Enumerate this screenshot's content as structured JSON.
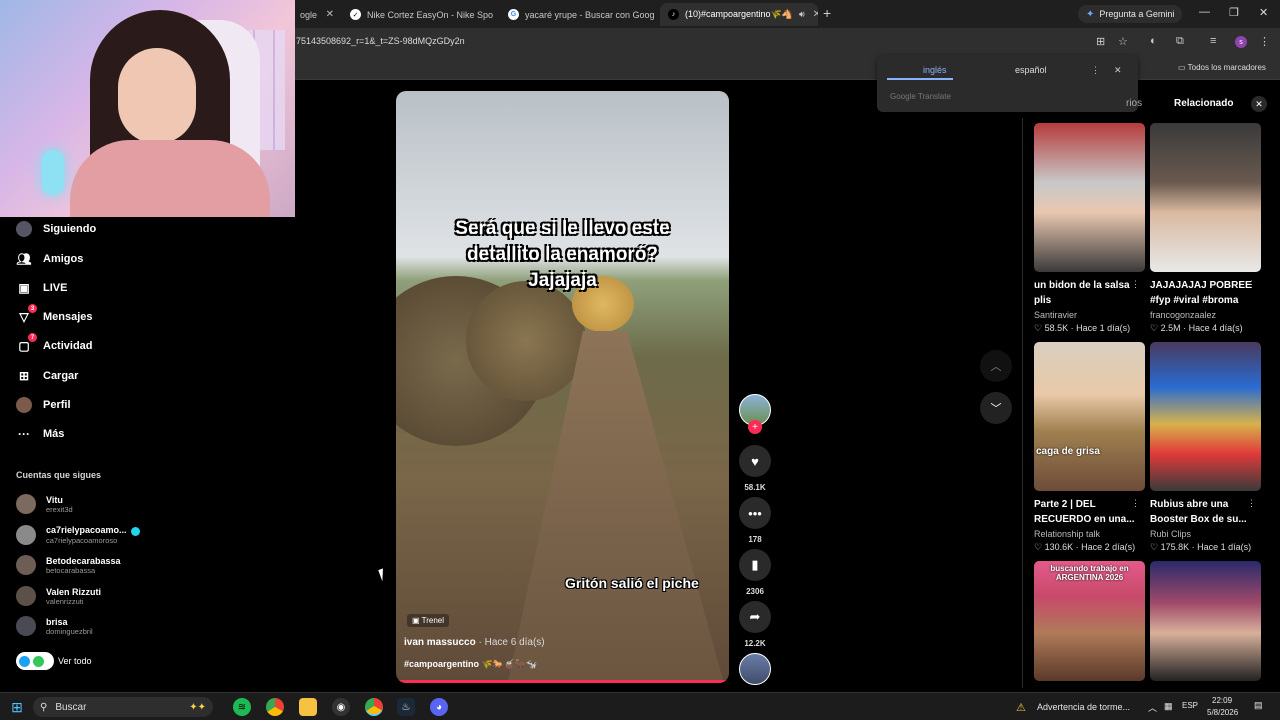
{
  "browser": {
    "tabs": [
      {
        "label": "ogle"
      },
      {
        "label": "Nike Cortez EasyOn - Nike Spo"
      },
      {
        "label": "yacaré yrupe - Buscar con Goog"
      },
      {
        "label": "(10)#campoargentino🌾🐴"
      }
    ],
    "gemini_label": "Pregunta a Gemini",
    "url": "75143508692_r=1&_t=ZS-98dMQzGDy2n",
    "all_bookmarks": "Todos los marcadores"
  },
  "translate": {
    "lang_source": "inglés",
    "lang_target": "español",
    "footer": "Google Translate"
  },
  "nav": {
    "items": [
      {
        "label": "Siguiendo",
        "icon": "following-avatar-icon"
      },
      {
        "label": "Amigos",
        "icon": "friends-icon"
      },
      {
        "label": "LIVE",
        "icon": "live-icon"
      },
      {
        "label": "Mensajes",
        "icon": "messages-icon",
        "badge": "3"
      },
      {
        "label": "Actividad",
        "icon": "activity-icon",
        "badge": "7"
      },
      {
        "label": "Cargar",
        "icon": "upload-icon"
      },
      {
        "label": "Perfil",
        "icon": "profile-icon"
      },
      {
        "label": "Más",
        "icon": "more-icon"
      }
    ],
    "following_heading": "Cuentas que sigues",
    "accounts": [
      {
        "name": "Vitu",
        "user": "erexit3d",
        "verified": false
      },
      {
        "name": "ca7rielypacoamo...",
        "user": "ca7rielypacoamoroso",
        "verified": true
      },
      {
        "name": "Betodecarabassa",
        "user": "betocarabassa",
        "verified": false
      },
      {
        "name": "Valen Rizzuti",
        "user": "valenrizzuti",
        "verified": false
      },
      {
        "name": "brisa",
        "user": "dominguezbril",
        "verified": false
      }
    ],
    "see_all": "Ver todo"
  },
  "video": {
    "caption_top": [
      "Será que si le llevo este",
      "detallito la enamoró?",
      "Jajajaja"
    ],
    "caption_bottom": "Gritón salió el piche",
    "effect": "Trenel",
    "author": "ivan massucco",
    "posted": "· Hace 6 día(s)",
    "hashtag": "#campoargentino 🌾🐎🧉🐂🐄"
  },
  "actions": {
    "likes": "58.1K",
    "comments": "178",
    "saves": "2306",
    "shares": "12.2K"
  },
  "related": {
    "prev_tab": "rios",
    "title": "Relacionado",
    "cards": [
      {
        "title": "un bidon de la salsa plis",
        "author": "Santiravier",
        "likes": "58.5K",
        "age": "Hace 1 día(s)"
      },
      {
        "title": "JAJAJAJAJ POBREE #fyp #viral #broma",
        "author": "francogonzaalez",
        "likes": "2.5M",
        "age": "Hace 4 día(s)"
      },
      {
        "title": "Parte 2 | DEL RECUERDO en una...",
        "author": "Relationship talk",
        "likes": "130.6K",
        "age": "Hace 2 día(s)"
      },
      {
        "title": "Rubius abre una Booster Box de su...",
        "author": "Rubi Clips",
        "likes": "175.8K",
        "age": "Hace 1 día(s)"
      }
    ],
    "card3_overlay": "caga de grisa",
    "card5_overlay": "buscando trabajo en ARGENTINA 2026"
  },
  "taskbar": {
    "search": "Buscar",
    "weather": "Advertencia de torme...",
    "lang": "ESP",
    "time": "22:09",
    "date": "5/8/2026"
  }
}
